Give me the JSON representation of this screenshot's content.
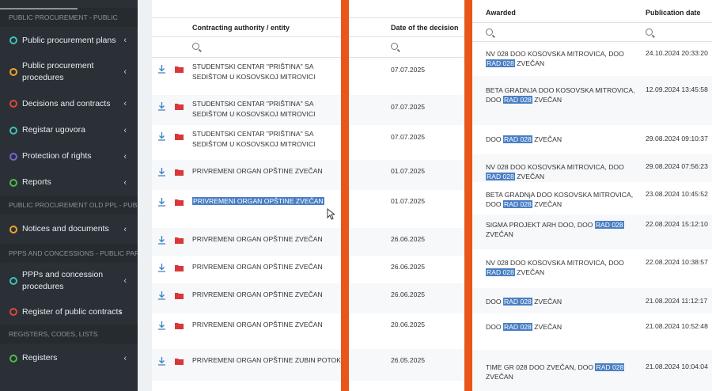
{
  "sidebar": {
    "sections": [
      {
        "title": "PUBLIC PROCUREMENT - PUBLIC",
        "items": [
          {
            "label": "Public procurement plans",
            "color": "#3fc1b4"
          },
          {
            "label": "Public procurement procedures",
            "color": "#f0a232"
          },
          {
            "label": "Decisions and contracts",
            "color": "#e0443a"
          },
          {
            "label": "Registar ugovora",
            "color": "#3fc1b4"
          },
          {
            "label": "Protection of rights",
            "color": "#7b62d6"
          },
          {
            "label": "Reports",
            "color": "#4fb94d"
          }
        ]
      },
      {
        "title": "PUBLIC PROCUREMENT OLD PPL - PUBLIC",
        "items": [
          {
            "label": "Notices and documents",
            "color": "#f0a232"
          }
        ]
      },
      {
        "title": "PPPs AND CONCESSIONS - PUBLIC PART",
        "items": [
          {
            "label": "PPPs and concession procedures",
            "color": "#3fc1b4"
          },
          {
            "label": "Register of public contracts",
            "color": "#e0443a"
          }
        ]
      },
      {
        "title": "REGISTERS, CODES, LISTS",
        "items": [
          {
            "label": "Registers",
            "color": "#4fb94d"
          }
        ]
      }
    ]
  },
  "table": {
    "col_entity": "Contracting authority / entity",
    "col_date": "Date of the decision",
    "rows": [
      {
        "entity": "STUDENTSKI CENTAR \"PRIŠTINA\" SA SEDIŠTOM U KOSOVSKOJ MITROVICI",
        "date": "07.07.2025"
      },
      {
        "entity": "STUDENTSKI CENTAR \"PRIŠTINA\" SA SEDIŠTOM U KOSOVSKOJ MITROVICI",
        "date": "07.07.2025"
      },
      {
        "entity": "STUDENTSKI CENTAR \"PRIŠTINA\" SA SEDIŠTOM U KOSOVSKOJ MITROVICI",
        "date": "07.07.2025"
      },
      {
        "entity": "PRIVREMENI ORGAN OPŠTINE ZVEČAN",
        "date": "01.07.2025"
      },
      {
        "entity": "PRIVREMENI ORGAN OPŠTINE ZVEČAN",
        "date": "01.07.2025"
      },
      {
        "entity": "PRIVREMENI ORGAN OPŠTINE ZVEČAN",
        "date": "26.06.2025"
      },
      {
        "entity": "PRIVREMENI ORGAN OPŠTINE ZVEČAN",
        "date": "26.06.2025"
      },
      {
        "entity": "PRIVREMENI ORGAN OPŠTINE ZVEČAN",
        "date": "26.06.2025"
      },
      {
        "entity": "PRIVREMENI ORGAN OPŠTINE ZVEČAN",
        "date": "20.06.2025"
      },
      {
        "entity": "PRIVREMENI ORGAN OPŠTINE ZUBIN POTOK",
        "date": "26.05.2025"
      }
    ]
  },
  "right": {
    "col_awarded": "Awarded",
    "col_pub": "Publication date",
    "highlight": "RAD 028",
    "rows": [
      {
        "pre": "NV 028 DOO KOSOVSKA MITROVICA, DOO ",
        "post": " ZVEČAN",
        "date": "24.10.2024 20:33:20"
      },
      {
        "pre": "BETA GRADNJA DOO KOSOVSKA MITROVICA, DOO ",
        "post": " ZVEČAN",
        "date": "12.09.2024 13:45:58"
      },
      {
        "pre": "DOO ",
        "post": " ZVEČAN",
        "date": "29.08.2024 09:10:37"
      },
      {
        "pre": "NV 028 DOO KOSOVSKA MITROVICA, DOO ",
        "post": " ZVEČAN",
        "date": "29.08.2024 07:56:23"
      },
      {
        "pre": "BETA GRADNjA DOO KOSOVSKA MITROVICA, DOO ",
        "post": " ZVEČAN",
        "date": "23.08.2024 10:45:52"
      },
      {
        "pre": "SIGMA PROJEKT ARH DOO, DOO ",
        "post": " ZVEČAN",
        "date": "22.08.2024 15:12:10"
      },
      {
        "pre": "NV 028 DOO KOSOVSKA MITROVICA, DOO ",
        "post": " ZVEČAN",
        "date": "22.08.2024 10:38:57"
      },
      {
        "pre": "DOO ",
        "post": " ZVEČAN",
        "date": "21.08.2024 11:12:17"
      },
      {
        "pre": "DOO ",
        "post": " ZVEČAN",
        "date": "21.08.2024 10:52:48"
      },
      {
        "pre": "TIME GR 028 DOO ZVEČAN, DOO ",
        "post": " ZVEČAN",
        "date": "21.08.2024 10:04:04"
      }
    ]
  }
}
